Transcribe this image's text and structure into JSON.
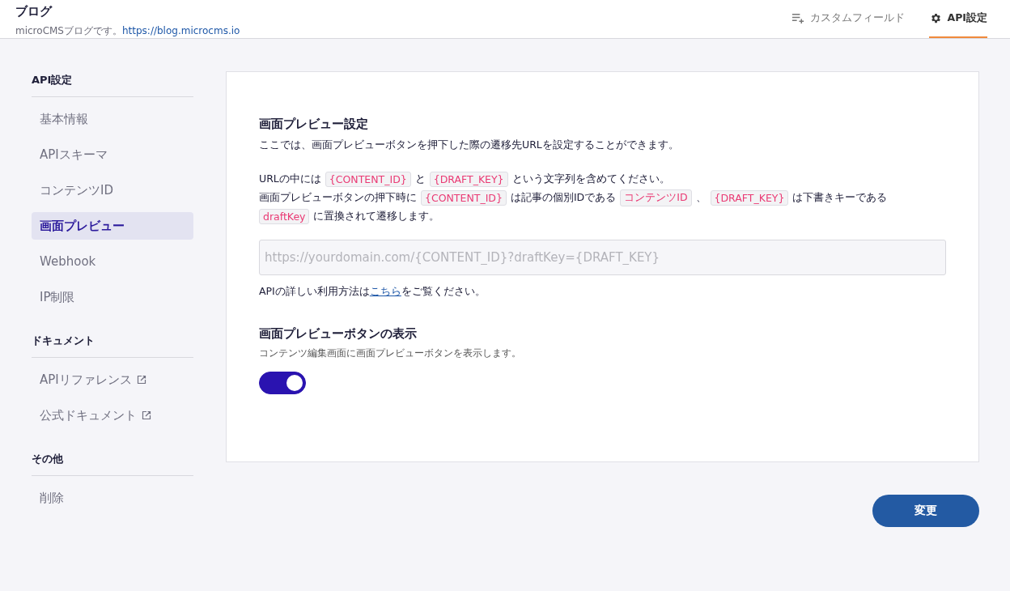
{
  "header": {
    "title": "ブログ",
    "description": "microCMSブログです。",
    "url": "https://blog.microcms.io",
    "tabs": [
      {
        "label": "カスタムフィールド",
        "kind": "fields",
        "selected": false
      },
      {
        "label": "API設定",
        "kind": "settings",
        "selected": true
      }
    ]
  },
  "sidebar": [
    {
      "heading": "API設定",
      "items": [
        {
          "label": "基本情報",
          "selected": false,
          "external": false
        },
        {
          "label": "APIスキーマ",
          "selected": false,
          "external": false
        },
        {
          "label": "コンテンツID",
          "selected": false,
          "external": false
        },
        {
          "label": "画面プレビュー",
          "selected": true,
          "external": false
        },
        {
          "label": "Webhook",
          "selected": false,
          "external": false
        },
        {
          "label": "IP制限",
          "selected": false,
          "external": false
        }
      ]
    },
    {
      "heading": "ドキュメント",
      "items": [
        {
          "label": "APIリファレンス",
          "selected": false,
          "external": true
        },
        {
          "label": "公式ドキュメント",
          "selected": false,
          "external": true
        }
      ]
    },
    {
      "heading": "その他",
      "items": [
        {
          "label": "削除",
          "selected": false,
          "external": false
        }
      ]
    }
  ],
  "preview": {
    "title": "画面プレビュー設定",
    "intro": "ここでは、画面プレビューボタンを押下した際の遷移先URLを設定することができます。",
    "lines": [
      [
        {
          "kind": "text",
          "text": "URLの中には"
        },
        {
          "kind": "code",
          "text": "{CONTENT_ID}"
        },
        {
          "kind": "text",
          "text": "と"
        },
        {
          "kind": "code",
          "text": "{DRAFT_KEY}"
        },
        {
          "kind": "text",
          "text": "という文字列を含めてください。"
        }
      ],
      [
        {
          "kind": "text",
          "text": "画面プレビューボタンの押下時に"
        },
        {
          "kind": "code",
          "text": "{CONTENT_ID}"
        },
        {
          "kind": "text",
          "text": "は記事の個別IDである"
        },
        {
          "kind": "code",
          "text": "コンテンツID"
        },
        {
          "kind": "text",
          "text": "、"
        },
        {
          "kind": "code",
          "text": "{DRAFT_KEY}"
        },
        {
          "kind": "text",
          "text": "は下書きキーである"
        }
      ],
      [
        {
          "kind": "code",
          "text": "draftKey"
        },
        {
          "kind": "text",
          "text": "に置換されて遷移します。"
        }
      ]
    ],
    "url_field": {
      "placeholder": "https://yourdomain.com/{CONTENT_ID}?draftKey={DRAFT_KEY}"
    },
    "help_before": "APIの詳しい利用方法は",
    "help_link": "こちら",
    "help_after": "をご覧ください。"
  },
  "display": {
    "title": "画面プレビューボタンの表示",
    "description": "コンテンツ編集画面に画面プレビューボタンを表示します。",
    "on": true
  },
  "submit": "変更"
}
